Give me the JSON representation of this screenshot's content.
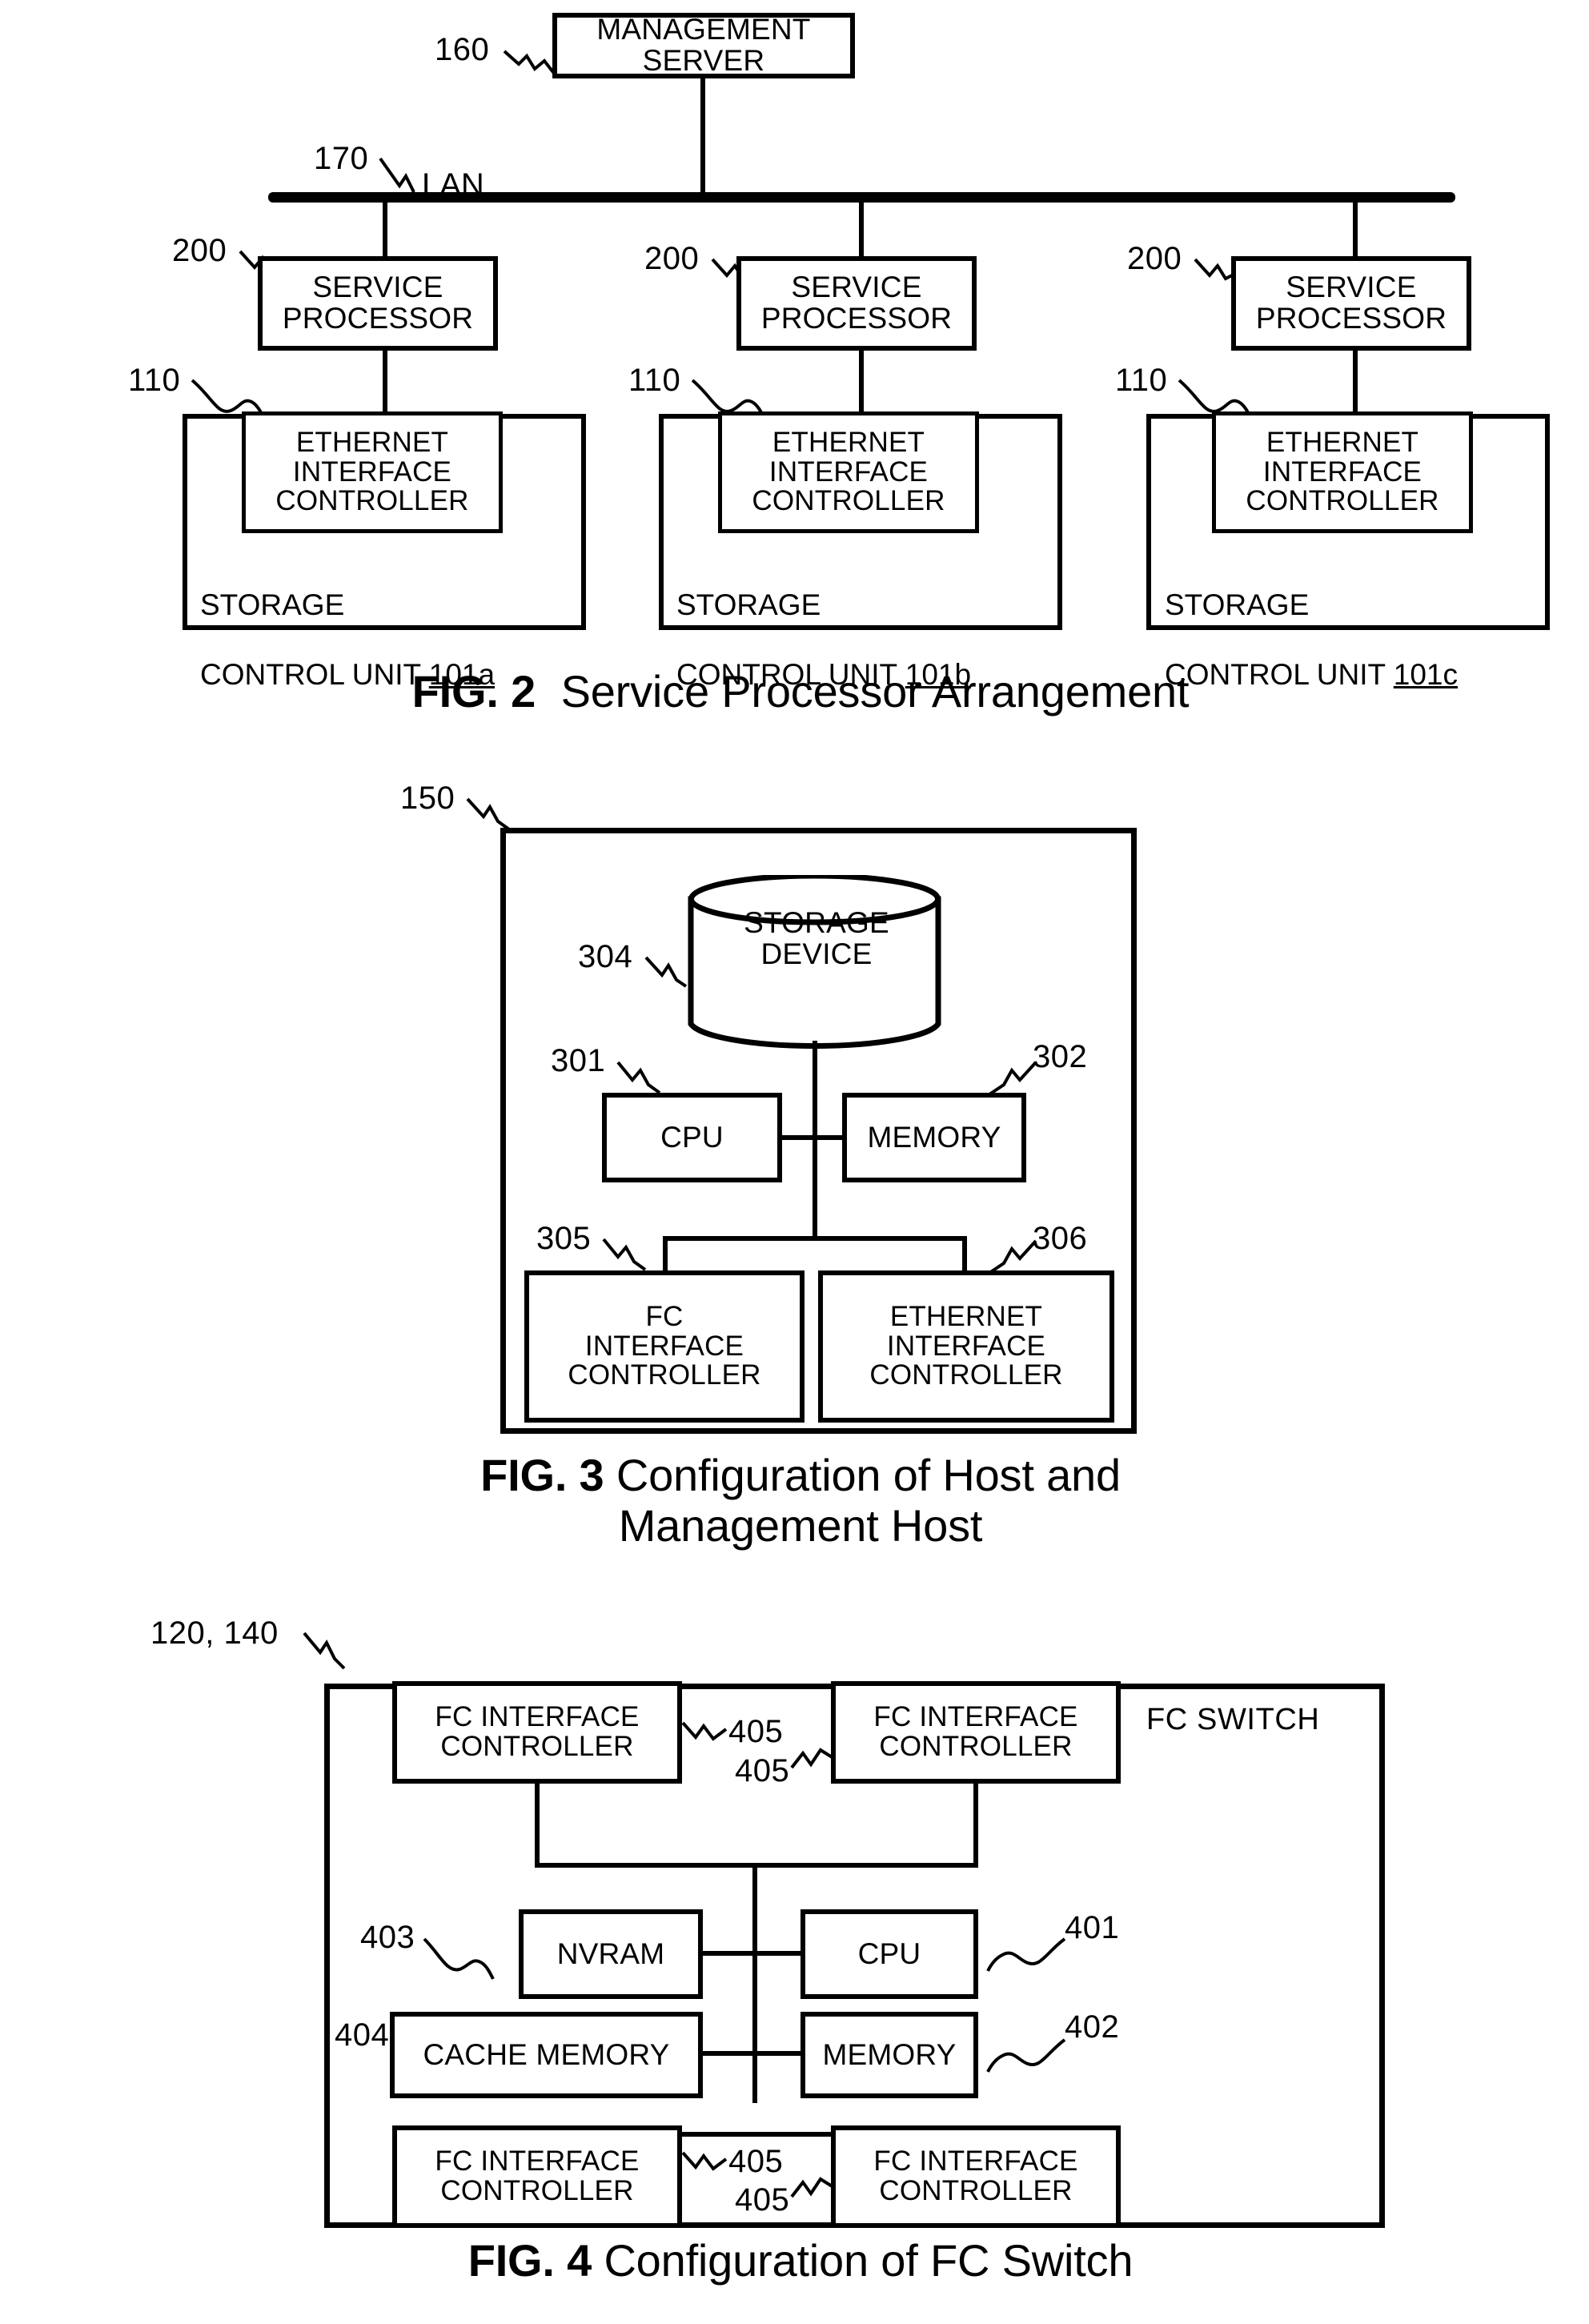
{
  "document": {
    "type": "patent-drawing-sheet",
    "figures": [
      "FIG. 2",
      "FIG. 3",
      "FIG. 4"
    ]
  },
  "fig2": {
    "caption_number": "FIG. 2",
    "caption_text": "Service Processor Arrangement",
    "management_server": {
      "label": "MANAGEMENT\nSERVER",
      "ref": "160"
    },
    "lan": {
      "label": "LAN",
      "ref": "170"
    },
    "service_processors": [
      {
        "label": "SERVICE\nPROCESSOR",
        "ref": "200"
      },
      {
        "label": "SERVICE\nPROCESSOR",
        "ref": "200"
      },
      {
        "label": "SERVICE\nPROCESSOR",
        "ref": "200"
      }
    ],
    "ethernet_controllers": [
      {
        "label": "ETHERNET\nINTERFACE\nCONTROLLER",
        "ref": "110"
      },
      {
        "label": "ETHERNET\nINTERFACE\nCONTROLLER",
        "ref": "110"
      },
      {
        "label": "ETHERNET\nINTERFACE\nCONTROLLER",
        "ref": "110"
      }
    ],
    "storage_control_units": [
      {
        "line1": "STORAGE",
        "line2": "CONTROL UNIT ",
        "ref": "101a"
      },
      {
        "line1": "STORAGE",
        "line2": "CONTROL UNIT ",
        "ref": "101b"
      },
      {
        "line1": "STORAGE",
        "line2": "CONTROL UNIT ",
        "ref": "101c"
      }
    ]
  },
  "fig3": {
    "caption_number": "FIG. 3",
    "caption_text": "Configuration of Host and\nManagement Host",
    "host_ref": "150",
    "storage_device": {
      "label": "STORAGE\nDEVICE",
      "ref": "304"
    },
    "cpu": {
      "label": "CPU",
      "ref": "301"
    },
    "memory": {
      "label": "MEMORY",
      "ref": "302"
    },
    "fc_interface_controller": {
      "label": "FC\nINTERFACE\nCONTROLLER",
      "ref": "305"
    },
    "ethernet_interface_controller": {
      "label": "ETHERNET\nINTERFACE\nCONTROLLER",
      "ref": "306"
    }
  },
  "fig4": {
    "caption_number": "FIG. 4",
    "caption_text": "Configuration of FC Switch",
    "switch_ref": "120, 140",
    "switch_label": "FC SWITCH",
    "fc_interface_controllers": [
      {
        "label": "FC INTERFACE\nCONTROLLER",
        "ref": "405"
      },
      {
        "label": "FC INTERFACE\nCONTROLLER",
        "ref": "405"
      },
      {
        "label": "FC INTERFACE\nCONTROLLER",
        "ref": "405"
      },
      {
        "label": "FC INTERFACE\nCONTROLLER",
        "ref": "405"
      }
    ],
    "nvram": {
      "label": "NVRAM",
      "ref": "403"
    },
    "cpu": {
      "label": "CPU",
      "ref": "401"
    },
    "cache_memory": {
      "label": "CACHE MEMORY",
      "ref": "404"
    },
    "memory": {
      "label": "MEMORY",
      "ref": "402"
    }
  }
}
